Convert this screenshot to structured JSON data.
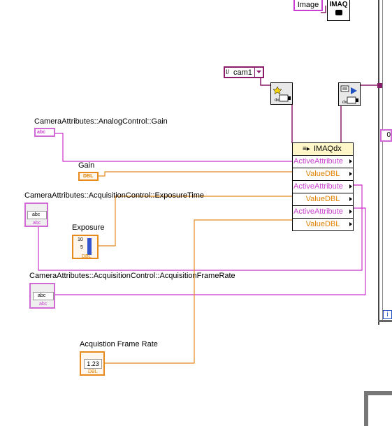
{
  "top_node": {
    "image_label": "Image",
    "imaq_label": "IMAQ"
  },
  "camera_constant": {
    "value": "cam1"
  },
  "open_icon": "open-camera-vi-icon",
  "configure_icon": "configure-grab-vi-icon",
  "constants": {
    "gain_attr": {
      "caption": "CameraAttributes::AnalogControl::Gain",
      "type_label": "abc"
    },
    "exposure_attr": {
      "caption": "CameraAttributes::AcquisitionControl::ExposureTime",
      "type_label": "abc",
      "sub_label": "abc"
    },
    "framerate_attr": {
      "caption": "CameraAttributes::AcquisitionControl::AcquisitionFrameRate",
      "type_label": "abc",
      "sub_label": "abc"
    }
  },
  "controls": {
    "gain": {
      "caption": "Gain",
      "type_label": "DBL"
    },
    "exposure": {
      "caption": "Exposure",
      "type_label": "DBL",
      "scale_top": "10",
      "scale_mid": "5"
    },
    "frame_rate": {
      "caption": "Acquistion Frame Rate",
      "value": "1.23",
      "type_label": "DBL"
    }
  },
  "property_node": {
    "title": "IMAQdx",
    "rows": [
      "ActiveAttribute",
      "ValueDBL",
      "ActiveAttribute",
      "ValueDBL",
      "ActiveAttribute",
      "ValueDBL"
    ]
  },
  "side_labels": {
    "right_stub": "0",
    "right_bottom": "i"
  },
  "colors": {
    "string_wire": "#cc33cc",
    "double_wire": "#e48a22",
    "session_wire": "#8a1a6a",
    "node_header": "#fff7c8"
  }
}
